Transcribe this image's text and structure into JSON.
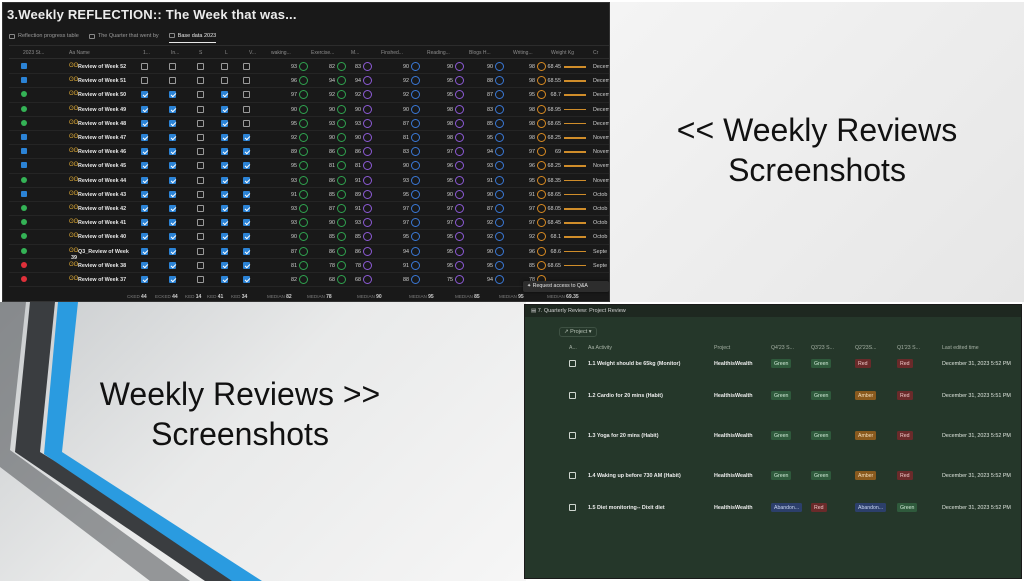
{
  "captions": {
    "right_top_line1": "<< Weekly Reviews",
    "right_top_line2": "Screenshots",
    "left_bottom_line1": "Weekly Reviews  >>",
    "left_bottom_line2": "Screenshots"
  },
  "colors": {
    "table_bg": "#191919",
    "project_bg": "#25372a",
    "accent_blue": "#2b83d6",
    "stripe_blue": "#2a9be0",
    "stripe_dark": "#3a3d40"
  },
  "weekly_table": {
    "title": "3.Weekly REFLECTION:: The Week that was...",
    "views": [
      {
        "label": "Reflection progress table",
        "icon": "table-icon",
        "active": false
      },
      {
        "label": "The Quarter that went by",
        "icon": "table-icon",
        "active": false
      },
      {
        "label": "Base data 2023",
        "icon": "table-icon",
        "active": true
      }
    ],
    "columns": [
      "2023 St...",
      "Aa Name",
      "1...",
      "In...",
      "S",
      "L",
      "V...",
      "waking...",
      "Exercise...",
      "M...",
      "Finshed...",
      "Reading...",
      "Blogs H...",
      "Writing...",
      "Weight Kg",
      "Cr"
    ],
    "rows": [
      {
        "status": "triangle",
        "status_color": "#2b83d6",
        "name": "Review of Week 52",
        "checks": [
          false,
          false,
          false,
          false,
          false
        ],
        "waking": "93",
        "exercise": "82",
        "m": "83",
        "finished": "90",
        "reading": "90",
        "blogs": "90",
        "writing": "98",
        "weight": "68.45",
        "month": "Decem"
      },
      {
        "status": "triangle",
        "status_color": "#2b83d6",
        "name": "Review of Week 51",
        "checks": [
          false,
          false,
          false,
          false,
          false
        ],
        "waking": "96",
        "exercise": "94",
        "m": "94",
        "finished": "92",
        "reading": "95",
        "blogs": "88",
        "writing": "98",
        "weight": "68.55",
        "month": "Decem"
      },
      {
        "status": "circle",
        "status_color": "#34b356",
        "name": "Review of Week 50",
        "checks": [
          true,
          true,
          false,
          true,
          false
        ],
        "waking": "97",
        "exercise": "92",
        "m": "92",
        "finished": "92",
        "reading": "95",
        "blogs": "87",
        "writing": "95",
        "weight": "68.7",
        "month": "Decem"
      },
      {
        "status": "circle",
        "status_color": "#34b356",
        "name": "Review of Week 49",
        "checks": [
          true,
          true,
          false,
          true,
          false
        ],
        "waking": "90",
        "exercise": "90",
        "m": "90",
        "finished": "90",
        "reading": "98",
        "blogs": "83",
        "writing": "98",
        "weight": "68.95",
        "month": "Decem"
      },
      {
        "status": "circle",
        "status_color": "#34b356",
        "name": "Review of Week 48",
        "checks": [
          true,
          true,
          false,
          true,
          false
        ],
        "waking": "95",
        "exercise": "93",
        "m": "93",
        "finished": "87",
        "reading": "98",
        "blogs": "85",
        "writing": "98",
        "weight": "68.65",
        "month": "Decem"
      },
      {
        "status": "triangle",
        "status_color": "#2b83d6",
        "name": "Review of Week 47",
        "checks": [
          true,
          true,
          false,
          true,
          true
        ],
        "waking": "92",
        "exercise": "90",
        "m": "90",
        "finished": "81",
        "reading": "98",
        "blogs": "95",
        "writing": "98",
        "weight": "68.25",
        "month": "Novem"
      },
      {
        "status": "triangle",
        "status_color": "#2b83d6",
        "name": "Review of Week 46",
        "checks": [
          true,
          true,
          false,
          true,
          true
        ],
        "waking": "89",
        "exercise": "86",
        "m": "86",
        "finished": "83",
        "reading": "97",
        "blogs": "94",
        "writing": "97",
        "weight": "69",
        "month": "Novem"
      },
      {
        "status": "triangle",
        "status_color": "#2b83d6",
        "name": "Review of Week 45",
        "checks": [
          true,
          true,
          false,
          true,
          true
        ],
        "waking": "95",
        "exercise": "81",
        "m": "81",
        "finished": "90",
        "reading": "96",
        "blogs": "93",
        "writing": "96",
        "weight": "68.25",
        "month": "Novem"
      },
      {
        "status": "circle",
        "status_color": "#34b356",
        "name": "Review of Week 44",
        "checks": [
          true,
          true,
          false,
          true,
          true
        ],
        "waking": "93",
        "exercise": "86",
        "m": "91",
        "finished": "93",
        "reading": "95",
        "blogs": "91",
        "writing": "95",
        "weight": "68.35",
        "month": "Novem"
      },
      {
        "status": "triangle",
        "status_color": "#2b83d6",
        "name": "Review of Week 43",
        "checks": [
          true,
          true,
          false,
          true,
          true
        ],
        "waking": "91",
        "exercise": "85",
        "m": "89",
        "finished": "95",
        "reading": "90",
        "blogs": "90",
        "writing": "91",
        "weight": "68.65",
        "month": "Octob"
      },
      {
        "status": "circle",
        "status_color": "#34b356",
        "name": "Review of Week 42",
        "checks": [
          true,
          true,
          false,
          true,
          true
        ],
        "waking": "93",
        "exercise": "87",
        "m": "91",
        "finished": "97",
        "reading": "97",
        "blogs": "87",
        "writing": "97",
        "weight": "68.05",
        "month": "Octob"
      },
      {
        "status": "circle",
        "status_color": "#34b356",
        "name": "Review of Week 41",
        "checks": [
          true,
          true,
          false,
          true,
          true
        ],
        "waking": "93",
        "exercise": "90",
        "m": "93",
        "finished": "97",
        "reading": "97",
        "blogs": "92",
        "writing": "97",
        "weight": "68.45",
        "month": "Octob"
      },
      {
        "status": "circle",
        "status_color": "#34b356",
        "name": "Review of Week 40",
        "checks": [
          true,
          true,
          false,
          true,
          true
        ],
        "waking": "90",
        "exercise": "85",
        "m": "85",
        "finished": "95",
        "reading": "95",
        "blogs": "92",
        "writing": "92",
        "weight": "68.1",
        "month": "Octob"
      },
      {
        "status": "circle",
        "status_color": "#34b356",
        "name": "Q3_Review of Week",
        "name_line2": "39",
        "checks": [
          true,
          true,
          false,
          true,
          true
        ],
        "waking": "87",
        "exercise": "86",
        "m": "86",
        "finished": "94",
        "reading": "95",
        "blogs": "90",
        "writing": "96",
        "weight": "68.6",
        "month": "Septe"
      },
      {
        "status": "circle",
        "status_color": "#e0303a",
        "name": "Review of Week 38",
        "checks": [
          true,
          true,
          false,
          true,
          true
        ],
        "waking": "81",
        "exercise": "78",
        "m": "78",
        "finished": "91",
        "reading": "95",
        "blogs": "95",
        "writing": "85",
        "weight": "68.65",
        "month": "Septe"
      },
      {
        "status": "circle",
        "status_color": "#e0303a",
        "name": "Review of Week 37",
        "checks": [
          true,
          true,
          false,
          true,
          true
        ],
        "waking": "82",
        "exercise": "68",
        "m": "68",
        "finished": "88",
        "reading": "75",
        "blogs": "94",
        "writing": "78",
        "weight": "",
        "month": ""
      }
    ],
    "footer": [
      {
        "label": "CKED",
        "value": "44"
      },
      {
        "label": "ECKED",
        "value": "44"
      },
      {
        "label": "KED",
        "value": "14"
      },
      {
        "label": "KED",
        "value": "41"
      },
      {
        "label": "KED",
        "value": "34"
      },
      {
        "label": "MEDIAN",
        "value": "82"
      },
      {
        "label": "MEDIAN",
        "value": "78"
      },
      {
        "label": "MEDIAN",
        "value": "90"
      },
      {
        "label": "MEDIAN",
        "value": "95"
      },
      {
        "label": "MEDIAN",
        "value": "85"
      },
      {
        "label": "MEDIAN",
        "value": "95"
      },
      {
        "label": "MEDIAN",
        "value": "69.35"
      }
    ],
    "access_tooltip": "Request access to Q&A"
  },
  "project_review": {
    "title": "7. Quarterly Review: Project Review",
    "filter_label": "Project",
    "columns": [
      "A...",
      "Aa Activity",
      "Project",
      "Q4'23 S...",
      "Q3'23 S...",
      "Q2'23S...",
      "Q1'23 S...",
      "Last edited time"
    ],
    "rows": [
      {
        "activity": "1.1 Weight should be 65kg (Monitor)",
        "project": "HealthisWealth",
        "q4": "Green",
        "q3": "Green",
        "q2": "Red",
        "q1": "Red",
        "edited": "December 31, 2023 5:52 PM"
      },
      {
        "activity": "1.2 Cardio for 20 mins (Habit)",
        "project": "HealthisWealth",
        "q4": "Green",
        "q3": "Green",
        "q2": "Amber",
        "q1": "Red",
        "edited": "December 31, 2023 5:51 PM"
      },
      {
        "activity": "1.3 Yoga for 20 mins (Habit)",
        "project": "HealthisWealth",
        "q4": "Green",
        "q3": "Green",
        "q2": "Amber",
        "q1": "Red",
        "edited": "December 31, 2023 5:52 PM"
      },
      {
        "activity": "1.4 Waking up before 730 AM (Habit)",
        "project": "HealthisWealth",
        "q4": "Green",
        "q3": "Green",
        "q2": "Amber",
        "q1": "Red",
        "edited": "December 31, 2023 5:52 PM"
      },
      {
        "activity": "1.5 Diet monitoring-- Dixit diet",
        "project": "HealthisWealth",
        "q4": "Abandon...",
        "q3": "Red",
        "q2": "Abandon...",
        "q1": "Green",
        "edited": "December 31, 2023 5:52 PM"
      }
    ]
  }
}
